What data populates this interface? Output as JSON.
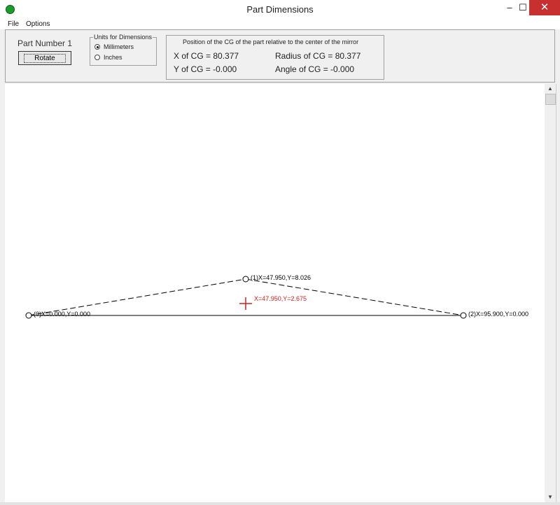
{
  "window": {
    "title": "Part Dimensions"
  },
  "title_controls": {
    "minimize": "–",
    "maximize": "☐",
    "close": "✕"
  },
  "menu": {
    "items": [
      "File",
      "Options"
    ]
  },
  "part_panel": {
    "part_number_label": "Part Number 1",
    "rotate_button": "Rotate"
  },
  "units_group": {
    "title": "Units for Dimensions",
    "options": [
      {
        "label": "Millimeters",
        "selected": true
      },
      {
        "label": "Inches",
        "selected": false
      }
    ]
  },
  "cg_info": {
    "heading": "Position of the CG of the part relative to the center of the mirror",
    "x_cg": "X of CG = 80.377",
    "radius_cg": "Radius of CG = 80.377",
    "y_cg": "Y of CG = -0.000",
    "angle_cg": "Angle of CG = -0.000"
  },
  "drawing": {
    "point_labels": [
      "(0)X=0.000,Y=0.000",
      "(1)X=47.950,Y=8.026",
      "(2)X=95.900,Y=0.000"
    ],
    "cg_label": "X=47.950,Y=2.675",
    "colors": {
      "line": "#000000",
      "cg_marker": "#cc2222"
    }
  }
}
